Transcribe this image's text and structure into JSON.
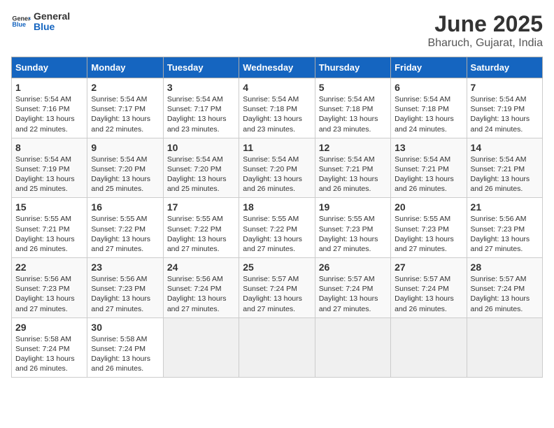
{
  "header": {
    "logo_general": "General",
    "logo_blue": "Blue",
    "title": "June 2025",
    "subtitle": "Bharuch, Gujarat, India"
  },
  "calendar": {
    "days_of_week": [
      "Sunday",
      "Monday",
      "Tuesday",
      "Wednesday",
      "Thursday",
      "Friday",
      "Saturday"
    ],
    "weeks": [
      [
        null,
        null,
        null,
        null,
        null,
        null,
        null
      ]
    ],
    "cells": [
      {
        "day": 1,
        "info": "Sunrise: 5:54 AM\nSunset: 7:16 PM\nDaylight: 13 hours\nand 22 minutes."
      },
      {
        "day": 2,
        "info": "Sunrise: 5:54 AM\nSunset: 7:17 PM\nDaylight: 13 hours\nand 22 minutes."
      },
      {
        "day": 3,
        "info": "Sunrise: 5:54 AM\nSunset: 7:17 PM\nDaylight: 13 hours\nand 23 minutes."
      },
      {
        "day": 4,
        "info": "Sunrise: 5:54 AM\nSunset: 7:18 PM\nDaylight: 13 hours\nand 23 minutes."
      },
      {
        "day": 5,
        "info": "Sunrise: 5:54 AM\nSunset: 7:18 PM\nDaylight: 13 hours\nand 23 minutes."
      },
      {
        "day": 6,
        "info": "Sunrise: 5:54 AM\nSunset: 7:18 PM\nDaylight: 13 hours\nand 24 minutes."
      },
      {
        "day": 7,
        "info": "Sunrise: 5:54 AM\nSunset: 7:19 PM\nDaylight: 13 hours\nand 24 minutes."
      },
      {
        "day": 8,
        "info": "Sunrise: 5:54 AM\nSunset: 7:19 PM\nDaylight: 13 hours\nand 25 minutes."
      },
      {
        "day": 9,
        "info": "Sunrise: 5:54 AM\nSunset: 7:20 PM\nDaylight: 13 hours\nand 25 minutes."
      },
      {
        "day": 10,
        "info": "Sunrise: 5:54 AM\nSunset: 7:20 PM\nDaylight: 13 hours\nand 25 minutes."
      },
      {
        "day": 11,
        "info": "Sunrise: 5:54 AM\nSunset: 7:20 PM\nDaylight: 13 hours\nand 26 minutes."
      },
      {
        "day": 12,
        "info": "Sunrise: 5:54 AM\nSunset: 7:21 PM\nDaylight: 13 hours\nand 26 minutes."
      },
      {
        "day": 13,
        "info": "Sunrise: 5:54 AM\nSunset: 7:21 PM\nDaylight: 13 hours\nand 26 minutes."
      },
      {
        "day": 14,
        "info": "Sunrise: 5:54 AM\nSunset: 7:21 PM\nDaylight: 13 hours\nand 26 minutes."
      },
      {
        "day": 15,
        "info": "Sunrise: 5:55 AM\nSunset: 7:21 PM\nDaylight: 13 hours\nand 26 minutes."
      },
      {
        "day": 16,
        "info": "Sunrise: 5:55 AM\nSunset: 7:22 PM\nDaylight: 13 hours\nand 27 minutes."
      },
      {
        "day": 17,
        "info": "Sunrise: 5:55 AM\nSunset: 7:22 PM\nDaylight: 13 hours\nand 27 minutes."
      },
      {
        "day": 18,
        "info": "Sunrise: 5:55 AM\nSunset: 7:22 PM\nDaylight: 13 hours\nand 27 minutes."
      },
      {
        "day": 19,
        "info": "Sunrise: 5:55 AM\nSunset: 7:23 PM\nDaylight: 13 hours\nand 27 minutes."
      },
      {
        "day": 20,
        "info": "Sunrise: 5:55 AM\nSunset: 7:23 PM\nDaylight: 13 hours\nand 27 minutes."
      },
      {
        "day": 21,
        "info": "Sunrise: 5:56 AM\nSunset: 7:23 PM\nDaylight: 13 hours\nand 27 minutes."
      },
      {
        "day": 22,
        "info": "Sunrise: 5:56 AM\nSunset: 7:23 PM\nDaylight: 13 hours\nand 27 minutes."
      },
      {
        "day": 23,
        "info": "Sunrise: 5:56 AM\nSunset: 7:23 PM\nDaylight: 13 hours\nand 27 minutes."
      },
      {
        "day": 24,
        "info": "Sunrise: 5:56 AM\nSunset: 7:24 PM\nDaylight: 13 hours\nand 27 minutes."
      },
      {
        "day": 25,
        "info": "Sunrise: 5:57 AM\nSunset: 7:24 PM\nDaylight: 13 hours\nand 27 minutes."
      },
      {
        "day": 26,
        "info": "Sunrise: 5:57 AM\nSunset: 7:24 PM\nDaylight: 13 hours\nand 27 minutes."
      },
      {
        "day": 27,
        "info": "Sunrise: 5:57 AM\nSunset: 7:24 PM\nDaylight: 13 hours\nand 26 minutes."
      },
      {
        "day": 28,
        "info": "Sunrise: 5:57 AM\nSunset: 7:24 PM\nDaylight: 13 hours\nand 26 minutes."
      },
      {
        "day": 29,
        "info": "Sunrise: 5:58 AM\nSunset: 7:24 PM\nDaylight: 13 hours\nand 26 minutes."
      },
      {
        "day": 30,
        "info": "Sunrise: 5:58 AM\nSunset: 7:24 PM\nDaylight: 13 hours\nand 26 minutes."
      }
    ]
  }
}
